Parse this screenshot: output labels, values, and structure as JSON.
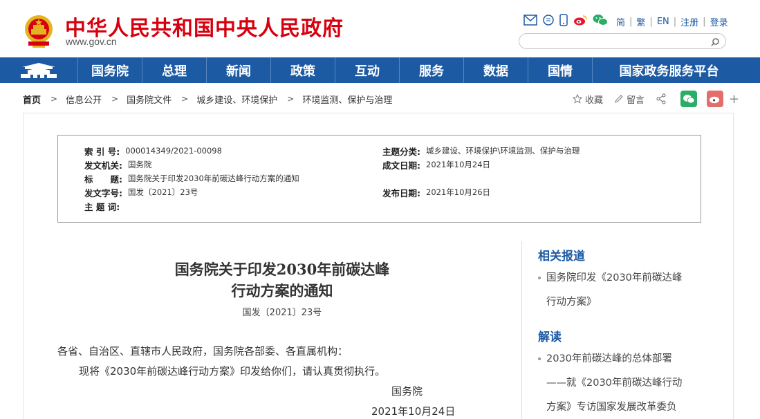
{
  "header": {
    "site_title": "中华人民共和国中央人民政府",
    "site_url": "www.gov.cn",
    "lang_links": [
      "简",
      "繁",
      "EN",
      "注册",
      "登录"
    ]
  },
  "nav": {
    "items": [
      "国务院",
      "总理",
      "新闻",
      "政策",
      "互动",
      "服务",
      "数据",
      "国情",
      "国家政务服务平台"
    ]
  },
  "breadcrumb": [
    "首页",
    "信息公开",
    "国务院文件",
    "城乡建设、环境保护",
    "环境监测、保护与治理"
  ],
  "share": {
    "favorite": "收藏",
    "comment": "留言"
  },
  "info": {
    "index_label": "索 引 号:",
    "index_value": "000014349/2021-00098",
    "subject_label": "主题分类:",
    "subject_value": "城乡建设、环境保护\\环境监测、保护与治理",
    "issuer_label": "发文机关:",
    "issuer_value": "国务院",
    "date_label": "成文日期:",
    "date_value": "2021年10月24日",
    "title_label": "标　　题:",
    "title_value": "国务院关于印发2030年前碳达峰行动方案的通知",
    "docno_label": "发文字号:",
    "docno_value": "国发〔2021〕23号",
    "publish_label": "发布日期:",
    "publish_value": "2021年10月26日",
    "keywords_label": "主 题 词:"
  },
  "article": {
    "title_line1": "国务院关于印发2030年前碳达峰",
    "title_line2": "行动方案的通知",
    "doc_no": "国发〔2021〕23号",
    "salutation": "各省、自治区、直辖市人民政府，国务院各部委、各直属机构：",
    "body": "现将《2030年前碳达峰行动方案》印发给你们，请认真贯彻执行。",
    "signature": "国务院",
    "sign_date": "2021年10月24日"
  },
  "sidebar": {
    "related_head": "相关报道",
    "related_line1": "国务院印发《2030年前碳达峰",
    "related_line2": "行动方案》",
    "interpret_head": "解读",
    "interpret_line1": "2030年前碳达峰的总体部署",
    "interpret_line2": "——就《2030年前碳达峰行动",
    "interpret_line3": "方案》专访国家发展改革委负"
  },
  "colors": {
    "brand_red": "#d7000f",
    "nav_blue": "#1c5aa3"
  }
}
